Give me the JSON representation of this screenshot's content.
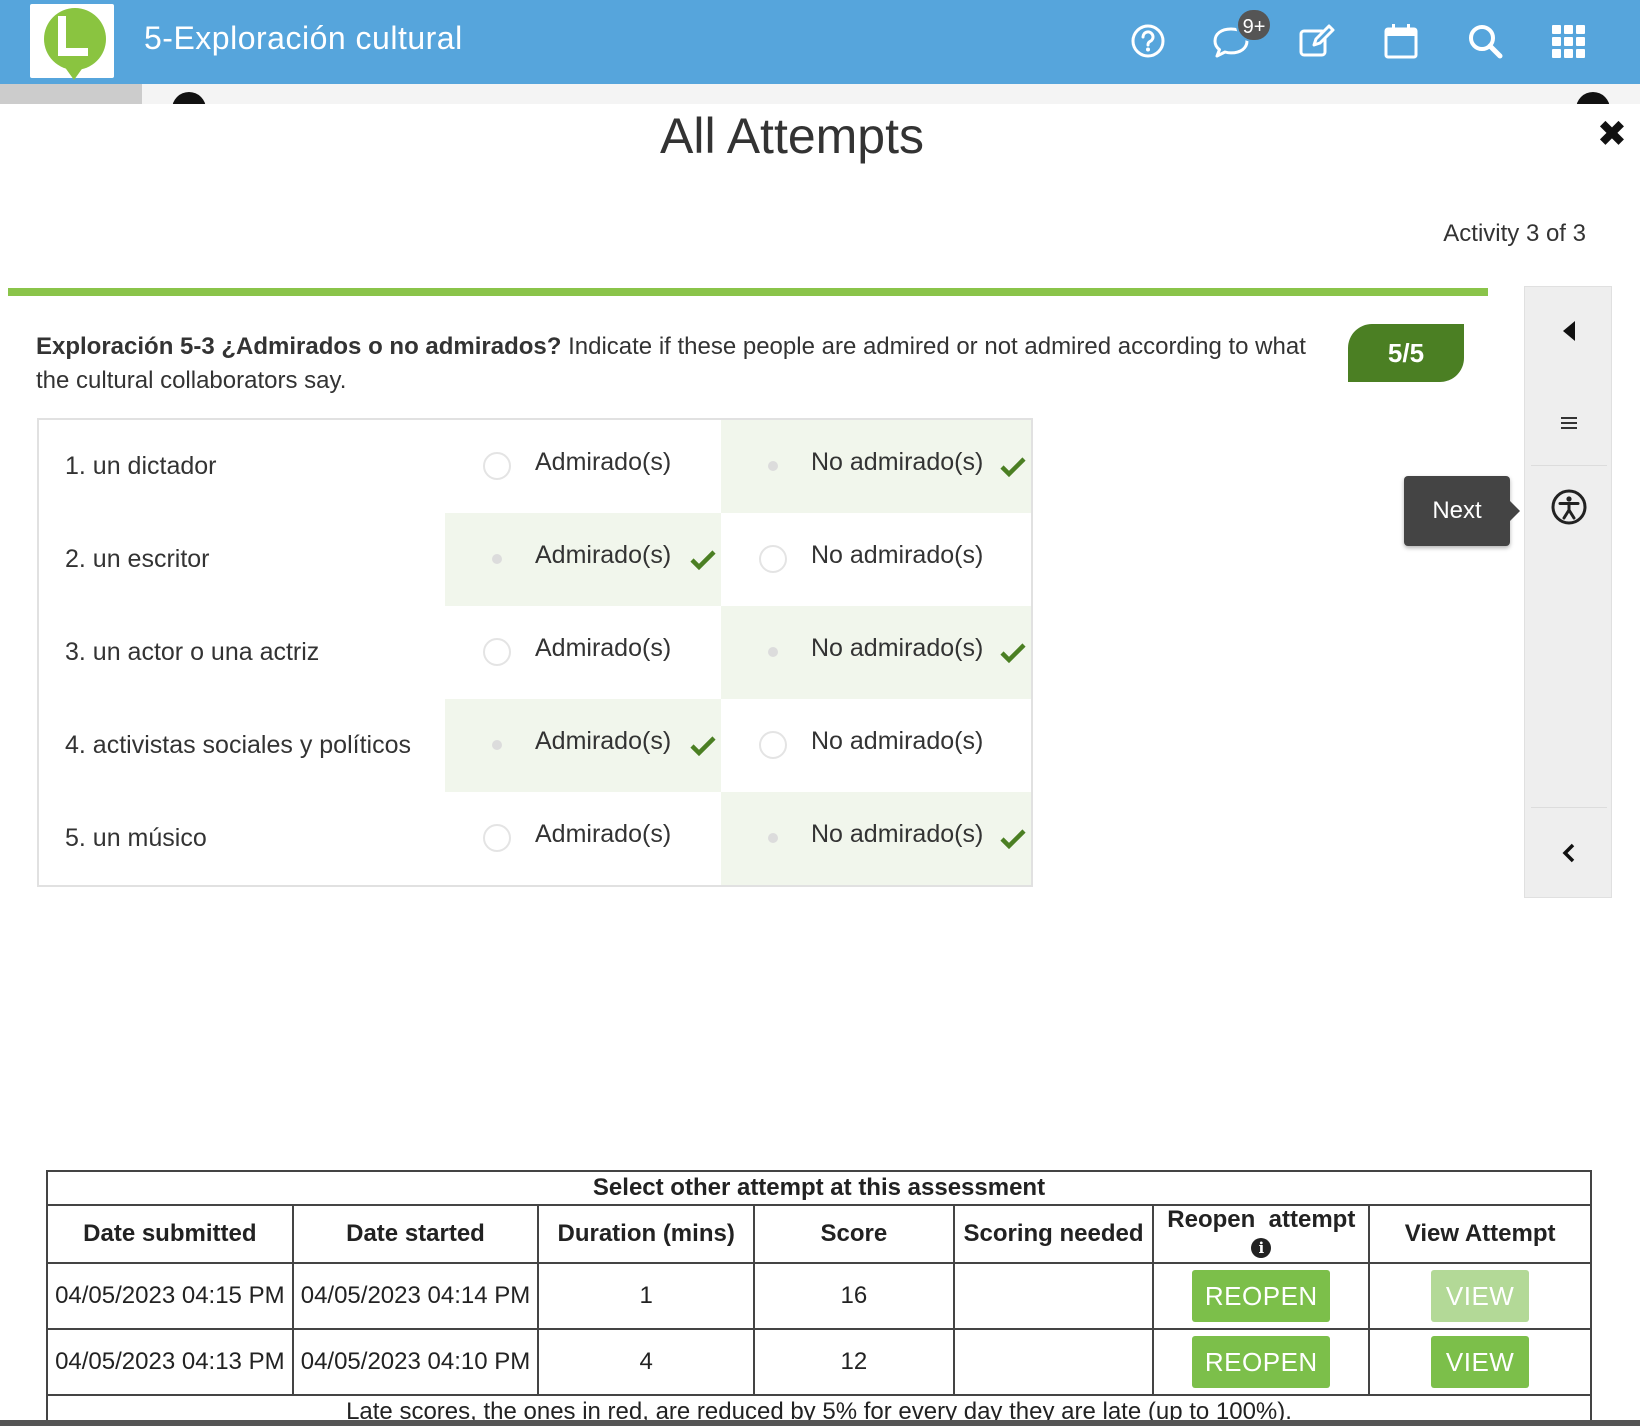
{
  "app": {
    "course_title": "5-Exploración cultural",
    "notifications_badge": "9+"
  },
  "modal": {
    "title": "All Attempts",
    "activity_counter": "Activity 3 of 3"
  },
  "question": {
    "title": "Exploración 5-3 ¿Admirados o no admirados?",
    "instructions": " Indicate if these people are admired or not admired according to what the cultural collaborators say.",
    "score": "5/5"
  },
  "items": [
    {
      "label": "1. un dictador",
      "opt1": "Admirado(s)",
      "opt2": "No admirado(s)",
      "selected": "opt2"
    },
    {
      "label": "2. un escritor",
      "opt1": "Admirado(s)",
      "opt2": "No admirado(s)",
      "selected": "opt1"
    },
    {
      "label": "3. un actor o una actriz",
      "opt1": "Admirado(s)",
      "opt2": "No admirado(s)",
      "selected": "opt2"
    },
    {
      "label": "4. activistas sociales y políticos",
      "opt1": "Admirado(s)",
      "opt2": "No admirado(s)",
      "selected": "opt1"
    },
    {
      "label": "5. un músico",
      "opt1": "Admirado(s)",
      "opt2": "No admirado(s)",
      "selected": "opt2"
    }
  ],
  "sidepanel": {
    "tooltip": "Next"
  },
  "attempts": {
    "caption": "Select other attempt at this assessment",
    "headers": [
      "Date submitted",
      "Date started",
      "Duration (mins)",
      "Score",
      "Scoring needed",
      "Reopen  attempt",
      "View Attempt"
    ],
    "rows": [
      {
        "submitted": "04/05/2023 04:15 PM",
        "started": "04/05/2023 04:14 PM",
        "duration": "1",
        "score": "16",
        "scoring_needed": "",
        "reopen": "REOPEN",
        "view": "VIEW"
      },
      {
        "submitted": "04/05/2023 04:13 PM",
        "started": "04/05/2023 04:10 PM",
        "duration": "4",
        "score": "12",
        "scoring_needed": "",
        "reopen": "REOPEN",
        "view": "VIEW"
      }
    ],
    "footnote": "Late scores, the ones in red, are reduced by 5% for every day they are late (up to 100%)."
  },
  "colors": {
    "topbar": "#56a5dc",
    "progress": "#8ac44a",
    "score_pill": "#4b7f23",
    "button_green": "#7cbf4a",
    "correct_bg": "#f1f6ec",
    "check": "#4b7f23"
  },
  "icons": [
    "help-icon",
    "chat-icon",
    "edit-icon",
    "calendar-icon",
    "search-icon",
    "apps-grid-icon",
    "close-icon",
    "triangle-left-icon",
    "menu-icon",
    "accessibility-icon",
    "chevron-left-icon",
    "checkmark-icon",
    "info-icon"
  ]
}
